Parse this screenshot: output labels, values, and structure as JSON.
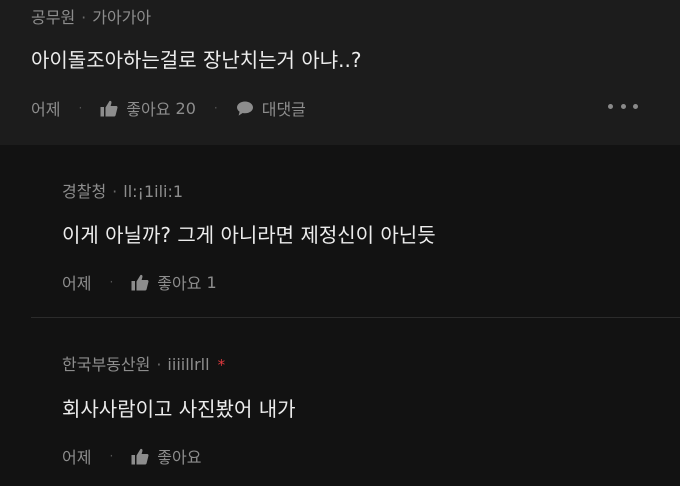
{
  "post": {
    "author": "공무원",
    "nickname": "가아가아",
    "text": "아이돌조아하는걸로 장난치는거 아냐..?",
    "time": "어제",
    "like_label": "좋아요",
    "like_count": "20",
    "reply_label": "대댓글",
    "more_icon": "more-dots-icon"
  },
  "replies": [
    {
      "author": "경찰청",
      "nickname": "ll:¡1ili:1",
      "text": "이게 아닐까? 그게 아니라면 제정신이 아닌듯",
      "time": "어제",
      "like_label": "좋아요",
      "like_count": "1"
    },
    {
      "author": "한국부동산원",
      "nickname": "iiiillrll",
      "badge": "*",
      "text": "회사사람이고 사진봤어 내가",
      "time": "어제",
      "like_label": "좋아요",
      "like_count": ""
    }
  ],
  "colors": {
    "badge": "#e0393e",
    "text": "#ececec",
    "muted": "#8d8d8d"
  }
}
